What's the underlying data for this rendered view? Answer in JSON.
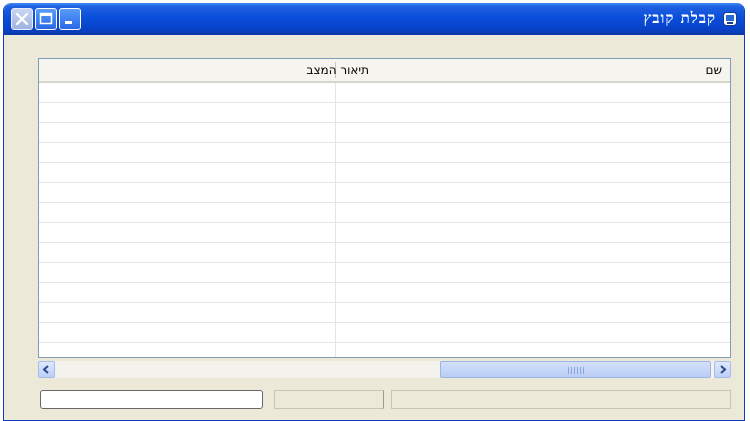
{
  "window": {
    "title": "קבלת קובץ",
    "title_icon": "app-icon",
    "buttons": {
      "close_icon": "close-icon",
      "maximize_icon": "maximize-icon",
      "minimize_icon": "minimize-icon"
    }
  },
  "list": {
    "columns": [
      "שם",
      "תיאור המצב"
    ],
    "rows": []
  },
  "scrollbar": {
    "left_icon": "chevron-left-icon",
    "right_icon": "chevron-right-icon"
  },
  "statusbar": {
    "panel_2_text": "",
    "panel_3_text": ""
  },
  "colors": {
    "titlebar": "#0a4fdb",
    "window_face": "#ece9d8",
    "list_border": "#7f9db9"
  }
}
